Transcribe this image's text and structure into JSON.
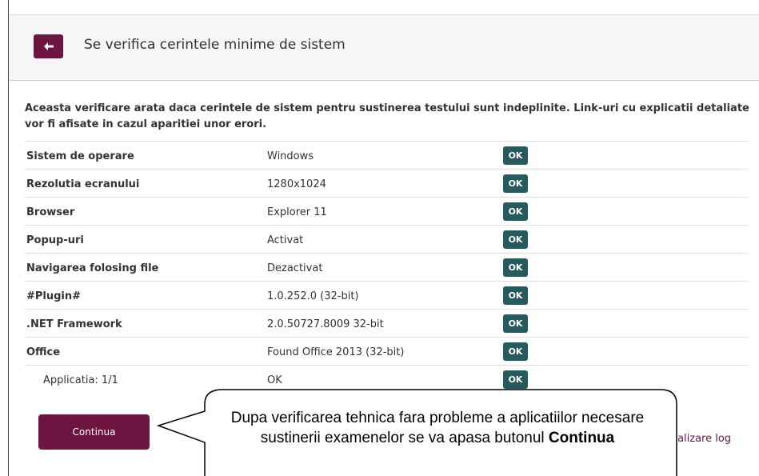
{
  "header": {
    "back_icon": "arrow-left-icon",
    "title": "Se verifica cerintele minime de sistem"
  },
  "intro": "Aceasta verificare arata daca cerintele de sistem pentru sustinerea testului sunt indeplinite. Link-uri cu explicatii detaliate vor fi afisate in cazul aparitiei unor erori.",
  "checks": [
    {
      "label": "Sistem de operare",
      "value": "Windows",
      "status": "OK"
    },
    {
      "label": "Rezolutia ecranului",
      "value": "1280x1024",
      "status": "OK"
    },
    {
      "label": "Browser",
      "value": "Explorer 11",
      "status": "OK"
    },
    {
      "label": "Popup-uri",
      "value": "Activat",
      "status": "OK"
    },
    {
      "label": "Navigarea folosing file",
      "value": "Dezactivat",
      "status": "OK"
    },
    {
      "label": "#Plugin#",
      "value": "1.0.252.0 (32-bit)",
      "status": "OK"
    },
    {
      "label": ".NET Framework",
      "value": "2.0.50727.8009 32-bit",
      "status": "OK"
    },
    {
      "label": "Office",
      "value": "Found Office 2013 (32-bit)",
      "status": "OK"
    },
    {
      "label": "Applicatia: 1/1",
      "value": "OK",
      "status": "OK"
    }
  ],
  "actions": {
    "continue_label": "Continua",
    "log_link_label": "zualizare log"
  },
  "callout": {
    "text_before": "Dupa verificarea tehnica fara probleme a aplicatiilor necesare sustinerii examenelor se va apasa butonul ",
    "text_bold": "Continua"
  },
  "colors": {
    "brand": "#6b1540",
    "ok_badge": "#265a5e"
  }
}
